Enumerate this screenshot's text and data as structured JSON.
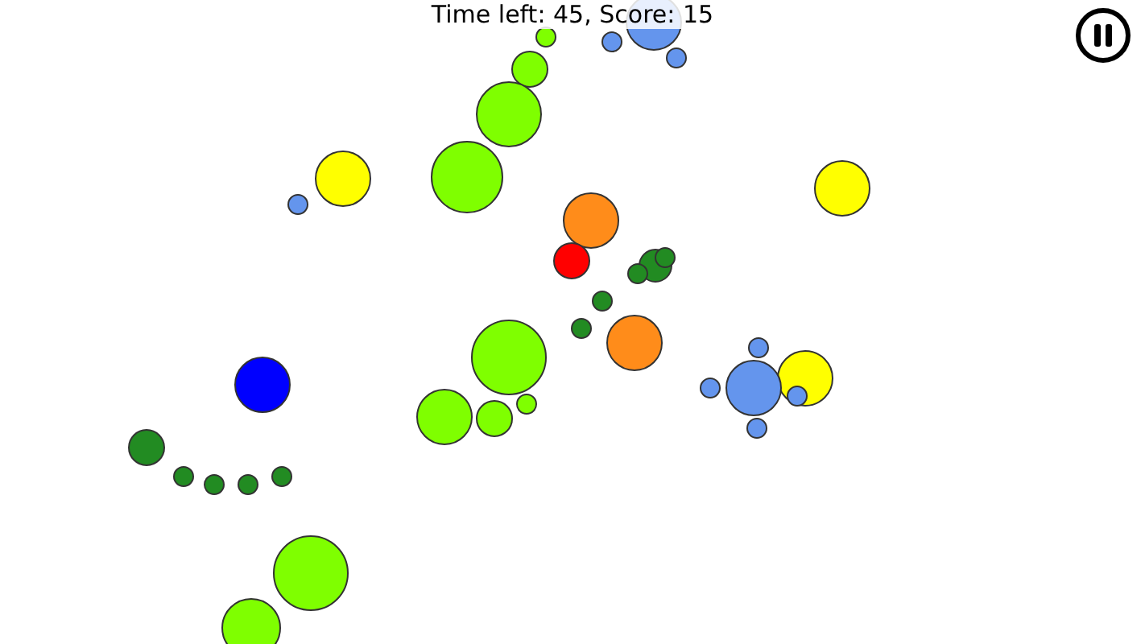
{
  "hud": {
    "status": "Time left: 45, Score: 15"
  }
}
